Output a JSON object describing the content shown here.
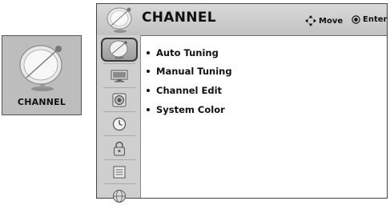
{
  "tile": {
    "label": "CHANNEL",
    "icon": "satellite-dish-icon"
  },
  "header": {
    "title": "CHANNEL",
    "icon": "satellite-dish-icon",
    "move_label": "Move",
    "enter_label": "Enter"
  },
  "sidebar": {
    "items": [
      {
        "icon": "satellite-dish-icon",
        "active": true
      },
      {
        "icon": "monitor-icon"
      },
      {
        "icon": "speaker-icon"
      },
      {
        "icon": "clock-icon"
      },
      {
        "icon": "lock-icon"
      },
      {
        "icon": "options-icon"
      },
      {
        "icon": "network-icon"
      }
    ]
  },
  "menu": {
    "items": [
      "Auto Tuning",
      "Manual Tuning",
      "Channel Edit",
      "System Color"
    ]
  }
}
